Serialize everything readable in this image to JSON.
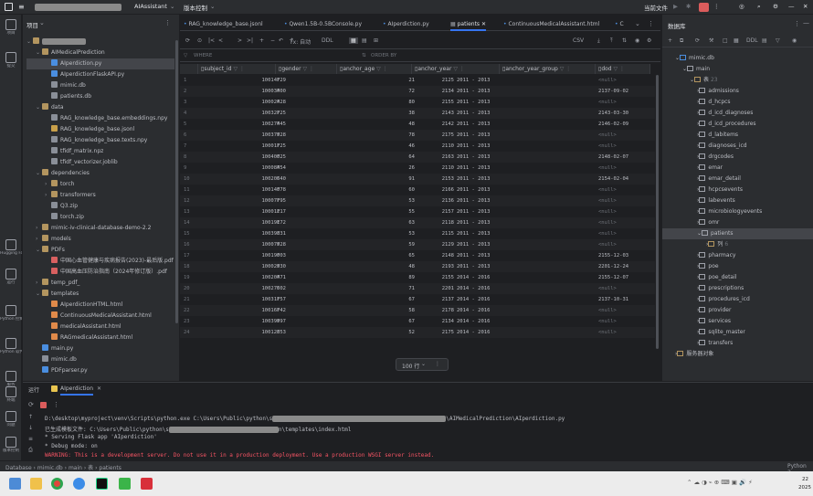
{
  "titlebar": {
    "project_name": "AIAssistant",
    "vcs": "版本控制",
    "current_file": "当前文件"
  },
  "left_strip": [
    {
      "label": "项目",
      "icon": "folder-icon"
    },
    {
      "label": "提交",
      "icon": "commit-icon"
    },
    {
      "label": "Hugging Face",
      "icon": "hugging-face-icon"
    },
    {
      "label": "运行",
      "icon": "run-icon"
    },
    {
      "label": "Python 控制台",
      "icon": "python-console-icon"
    },
    {
      "label": "Python 软件包",
      "icon": "python-packages-icon"
    },
    {
      "label": "服务",
      "icon": "services-icon"
    },
    {
      "label": "终端",
      "icon": "terminal-icon"
    },
    {
      "label": "问题",
      "icon": "problems-icon"
    },
    {
      "label": "版本控制",
      "icon": "vcs-icon"
    }
  ],
  "project": {
    "header": "项目",
    "tree": [
      {
        "name": "AIMedicalPrediction",
        "kind": "folder",
        "expanded": true
      },
      {
        "name": "AIperdiction.py",
        "kind": "py",
        "selected": true
      },
      {
        "name": "AIperdictionFlaskAPI.py",
        "kind": "py"
      },
      {
        "name": "mimic.db",
        "kind": "db"
      },
      {
        "name": "patients.db",
        "kind": "db"
      },
      {
        "name": "data",
        "kind": "folder",
        "expanded": true
      },
      {
        "name": "RAG_knowledge_base.embeddings.npy",
        "kind": "file"
      },
      {
        "name": "RAG_knowledge_base.jsonl",
        "kind": "json"
      },
      {
        "name": "RAG_knowledge_base.texts.npy",
        "kind": "file"
      },
      {
        "name": "tfidf_matrix.npz",
        "kind": "file"
      },
      {
        "name": "tfidf_vectorizer.joblib",
        "kind": "file"
      },
      {
        "name": "dependencies",
        "kind": "folder",
        "expanded": true
      },
      {
        "name": "torch",
        "kind": "folder",
        "expanded": false
      },
      {
        "name": "transformers",
        "kind": "folder",
        "expanded": false
      },
      {
        "name": "Q3.zip",
        "kind": "zip"
      },
      {
        "name": "torch.zip",
        "kind": "zip"
      },
      {
        "name": "mimic-iv-clinical-database-demo-2.2",
        "kind": "folder",
        "expanded": false
      },
      {
        "name": "models",
        "kind": "folder",
        "expanded": false
      },
      {
        "name": "PDFs",
        "kind": "folder",
        "expanded": true
      },
      {
        "name": "中国心血管健康与疾病报告(2023)-最后版.pdf",
        "kind": "pdf"
      },
      {
        "name": "中国高血压防治指南（2024年修订版）.pdf",
        "kind": "pdf"
      },
      {
        "name": "temp_pdf_",
        "kind": "folder",
        "expanded": false
      },
      {
        "name": "templates",
        "kind": "folder",
        "expanded": true
      },
      {
        "name": "AIperdictionHTML.html",
        "kind": "html"
      },
      {
        "name": "ContinuousMedicalAssistant.html",
        "kind": "html"
      },
      {
        "name": "medicalAssistant.html",
        "kind": "html"
      },
      {
        "name": "RAGmedicalAssistant.html",
        "kind": "html"
      },
      {
        "name": "main.py",
        "kind": "py"
      },
      {
        "name": "mimic.db",
        "kind": "db"
      },
      {
        "name": "PDFparser.py",
        "kind": "py"
      }
    ]
  },
  "editor": {
    "tabs": [
      {
        "label": "RAG_knowledge_base.jsonl",
        "active": false
      },
      {
        "label": "Qwen1.5B-0.5BConsole.py",
        "active": false
      },
      {
        "label": "AIperdiction.py",
        "active": false
      },
      {
        "label": "patients",
        "active": true
      },
      {
        "label": "ContinuousMedicalAssistant.html",
        "active": false
      },
      {
        "label": "C",
        "active": false
      }
    ],
    "toolbar": {
      "tx_label": "Tx: 自动",
      "ddl_label": "DDL",
      "export_label": "CSV"
    },
    "filter": {
      "where_label": "WHERE",
      "orderby_label": "ORDER BY"
    },
    "columns": [
      "subject_id",
      "gender",
      "anchor_age",
      "anchor_year",
      "anchor_year_group",
      "dod"
    ],
    "rows": [
      [
        "1",
        "10014729",
        "F",
        "21",
        "2125",
        "2011 - 2013",
        "<null>"
      ],
      [
        "2",
        "10003400",
        "F",
        "72",
        "2134",
        "2011 - 2013",
        "2137-09-02"
      ],
      [
        "3",
        "10002428",
        "F",
        "80",
        "2155",
        "2011 - 2013",
        "<null>"
      ],
      [
        "4",
        "10032725",
        "F",
        "38",
        "2143",
        "2011 - 2013",
        "2143-03-30"
      ],
      [
        "5",
        "10027445",
        "F",
        "48",
        "2142",
        "2011 - 2013",
        "2146-02-09"
      ],
      [
        "6",
        "10037928",
        "F",
        "78",
        "2175",
        "2011 - 2013",
        "<null>"
      ],
      [
        "7",
        "10001725",
        "F",
        "46",
        "2110",
        "2011 - 2013",
        "<null>"
      ],
      [
        "8",
        "10040025",
        "F",
        "64",
        "2163",
        "2011 - 2013",
        "2148-02-07"
      ],
      [
        "9",
        "10008454",
        "F",
        "26",
        "2110",
        "2011 - 2013",
        "<null>"
      ],
      [
        "10",
        "10020640",
        "F",
        "91",
        "2153",
        "2011 - 2013",
        "2154-02-04"
      ],
      [
        "11",
        "10014078",
        "F",
        "60",
        "2166",
        "2011 - 2013",
        "<null>"
      ],
      [
        "12",
        "10007795",
        "F",
        "53",
        "2136",
        "2011 - 2013",
        "<null>"
      ],
      [
        "13",
        "10001217",
        "F",
        "55",
        "2157",
        "2011 - 2013",
        "<null>"
      ],
      [
        "14",
        "10019172",
        "F",
        "63",
        "2118",
        "2011 - 2013",
        "<null>"
      ],
      [
        "15",
        "10039831",
        "F",
        "53",
        "2115",
        "2011 - 2013",
        "<null>"
      ],
      [
        "16",
        "10007928",
        "F",
        "59",
        "2129",
        "2011 - 2013",
        "<null>"
      ],
      [
        "17",
        "10019003",
        "F",
        "65",
        "2148",
        "2011 - 2013",
        "2155-12-03"
      ],
      [
        "18",
        "10002930",
        "F",
        "48",
        "2193",
        "2011 - 2013",
        "2201-12-24"
      ],
      [
        "19",
        "10020471",
        "F",
        "89",
        "2155",
        "2014 - 2016",
        "2155-12-07"
      ],
      [
        "20",
        "10027602",
        "F",
        "71",
        "2201",
        "2014 - 2016",
        "<null>"
      ],
      [
        "21",
        "10031757",
        "F",
        "67",
        "2137",
        "2014 - 2016",
        "2137-10-31"
      ],
      [
        "22",
        "10016742",
        "F",
        "58",
        "2178",
        "2014 - 2016",
        "<null>"
      ],
      [
        "23",
        "10039997",
        "F",
        "67",
        "2134",
        "2014 - 2016",
        "<null>"
      ],
      [
        "24",
        "10012853",
        "F",
        "52",
        "2175",
        "2014 - 2016",
        "<null>"
      ]
    ],
    "page_size": "100 行"
  },
  "database": {
    "header": "数据库",
    "connection": "mimic.db",
    "schema": "main",
    "tables_folder": "表",
    "tables_count": "23",
    "tables": [
      "admissions",
      "d_hcpcs",
      "d_icd_diagnoses",
      "d_icd_procedures",
      "d_labitems",
      "diagnoses_icd",
      "drgcodes",
      "emar",
      "emar_detail",
      "hcpcsevents",
      "labevents",
      "microbiologyevents",
      "omr",
      "patients",
      "pharmacy",
      "poe",
      "poe_detail",
      "prescriptions",
      "procedures_icd",
      "provider",
      "services",
      "sqlite_master",
      "transfers"
    ],
    "selected_table": "patients",
    "columns_node": "列",
    "columns_count": "6",
    "server_objects": "服务器对象"
  },
  "run": {
    "tab_label": "运行",
    "config": "AIperdiction",
    "lines": [
      {
        "text": "D:\\desktop\\myproject\\venv\\Scripts\\python.exe C:\\Users\\Public\\python\\s",
        "tail": "\\AIMedicalPrediction\\AIperdiction.py",
        "style": "normal"
      },
      {
        "text": "已生成模板文件: C:\\Users\\Public\\python\\s",
        "tail": "n\\templates\\index.html",
        "style": "normal"
      },
      {
        "text": " * Serving Flask app 'AIperdiction'",
        "tail": "",
        "style": "normal"
      },
      {
        "text": " * Debug mode: on",
        "tail": "",
        "style": "normal"
      },
      {
        "text": "WARNING: This is a development server. Do not use it in a production deployment. Use a production WSGI server instead.",
        "tail": "",
        "style": "warning"
      }
    ]
  },
  "statusbar": {
    "crumbs": [
      "Database",
      "mimic.db",
      "main",
      "表",
      "patients"
    ],
    "interpreter": "Python 3."
  },
  "taskbar": {
    "clock_time": "22",
    "clock_date": "2025"
  },
  "colors": {
    "accent": "#3574f0",
    "warning": "#f75464",
    "null": "#6f737a",
    "number": "#2aacb8",
    "string": "#6aab73"
  }
}
